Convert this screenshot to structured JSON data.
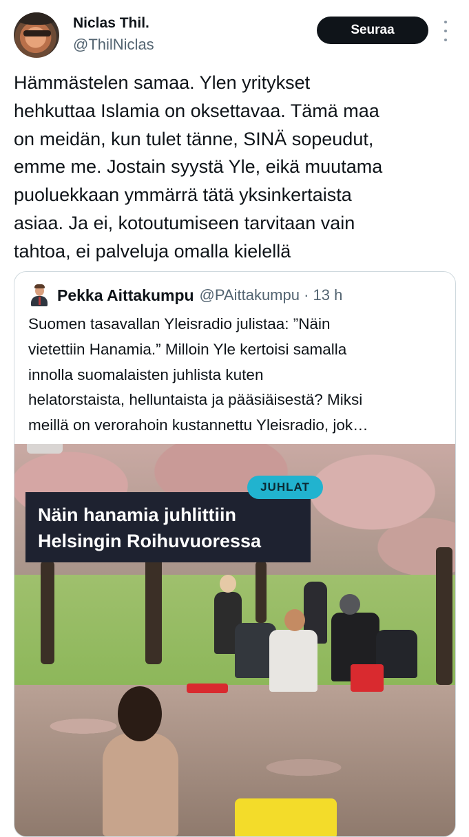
{
  "author": {
    "name": "Niclas Thil.",
    "handle": "@ThilNiclas",
    "follow_label": "Seuraa"
  },
  "tweet": {
    "lines": [
      "Hämmästelen samaa. Ylen yritykset",
      "hehkuttaa Islamia on oksettavaa. Tämä maa",
      "on meidän, kun tulet tänne, SINÄ sopeudut,",
      "emme me. Jostain syystä Yle, eikä muutama",
      "puoluekkaan ymmärrä tätä yksinkertaista",
      "asiaa. Ja ei, kotoutumiseen tarvitaan vain",
      "tahtoa, ei palveluja omalla kielellä"
    ]
  },
  "quote": {
    "author_name": "Pekka Aittakumpu",
    "author_handle": "@PAittakumpu · 13 h",
    "lines": [
      "Suomen tasavallan Yleisradio julistaa: ”Näin",
      "vietettiin Hanamia.” Milloin Yle kertoisi samalla",
      "innolla suomalaisten juhlista kuten",
      "helatorstaista, helluntaista ja pääsiäisestä? Miksi",
      "meillä on verorahoin kustannettu Yleisradio, jok…"
    ],
    "media": {
      "tag": "JUHLAT",
      "title_line1": "Näin hanamia juhlittiin",
      "title_line2": "Helsingin Roihuvuoressa"
    }
  },
  "colors": {
    "text": "#0f1419",
    "secondary": "#536471",
    "follow_bg": "#0f1419",
    "tag_bg": "#21b3cf",
    "title_bg": "#1e2230"
  }
}
